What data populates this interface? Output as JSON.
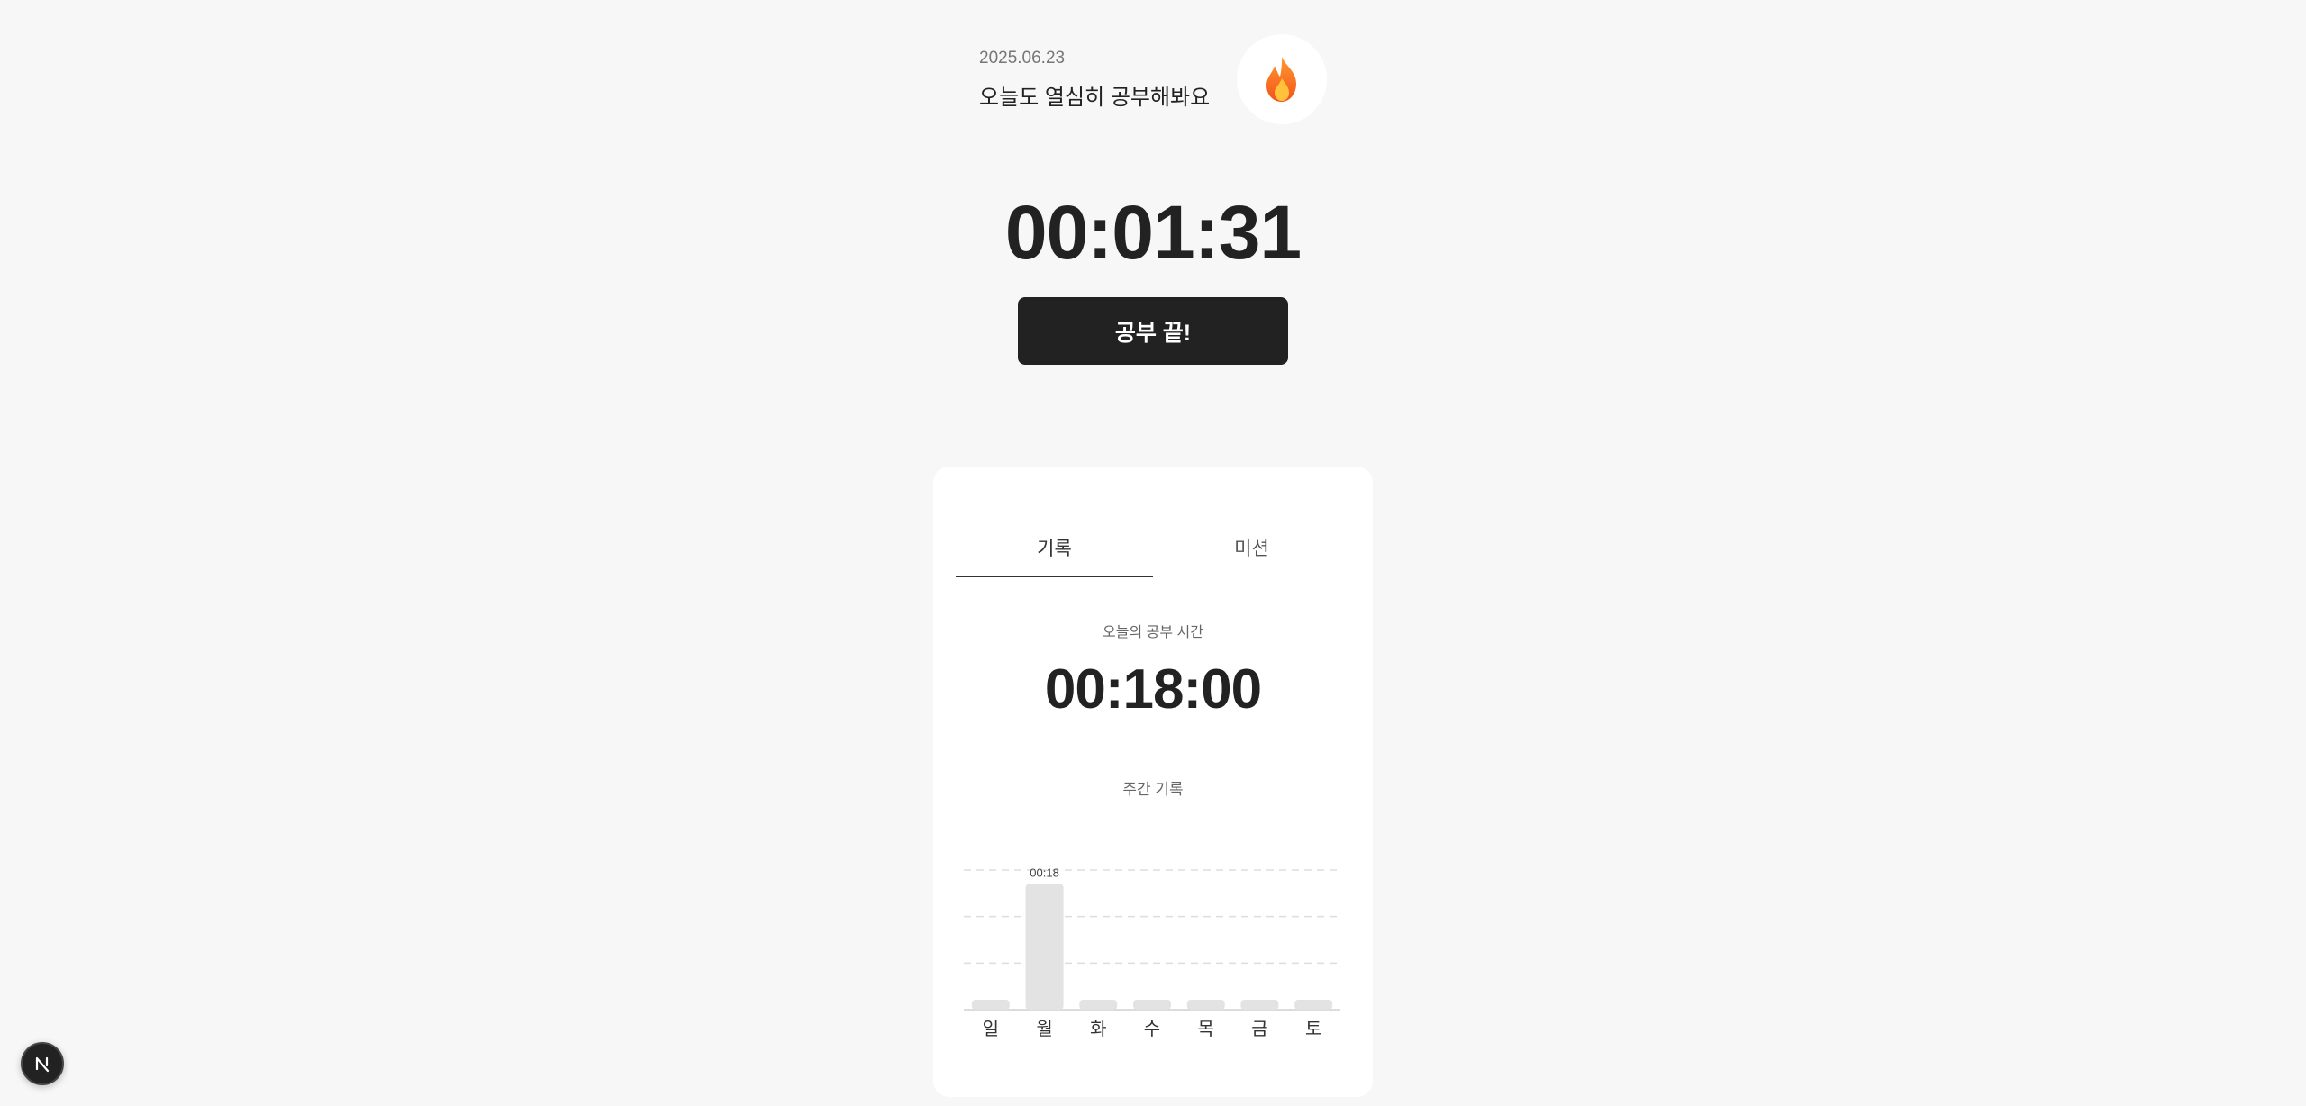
{
  "header": {
    "date": "2025.06.23",
    "greeting": "오늘도 열심히 공부해봐요",
    "streak_icon": "flame-icon"
  },
  "timer": {
    "value": "00:01:31",
    "end_button_label": "공부 끝!"
  },
  "card": {
    "tabs": [
      {
        "label": "기록",
        "active": true
      },
      {
        "label": "미션",
        "active": false
      }
    ],
    "today_label": "오늘의 공부 시간",
    "today_time": "00:18:00",
    "weekly_label": "주간 기록"
  },
  "chart_data": {
    "type": "bar",
    "categories": [
      "일",
      "월",
      "화",
      "수",
      "목",
      "금",
      "토"
    ],
    "values": [
      0,
      18,
      0,
      0,
      0,
      0,
      0
    ],
    "data_labels": [
      "",
      "00:18",
      "",
      "",
      "",
      "",
      ""
    ],
    "ylim": [
      0,
      20
    ],
    "grid": true
  },
  "colors": {
    "background": "#f7f7f7",
    "card": "#ffffff",
    "primary_button": "#222222",
    "bar": "#e3e3e3"
  },
  "badge": {
    "icon": "nextjs-logo-icon"
  }
}
